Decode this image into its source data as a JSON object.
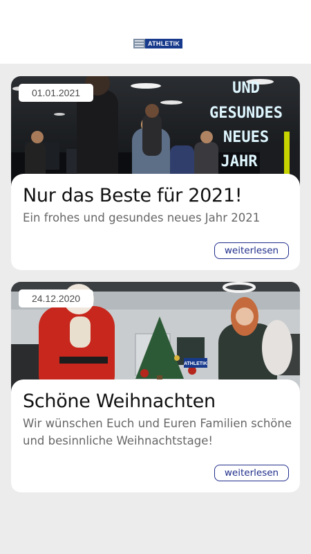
{
  "header": {
    "logo_text": "ATHLETIK"
  },
  "posts": [
    {
      "date": "01.01.2021",
      "title": "Nur das Beste für 2021!",
      "excerpt": "Ein frohes und gesundes neues Jahr 2021",
      "read_more_label": "weiterlesen",
      "image_text": [
        "UND",
        "GESUNDES",
        "NEUES",
        "JAHR"
      ]
    },
    {
      "date": "24.12.2020",
      "title": "Schöne Weihnachten",
      "excerpt": "Wir wünschen Euch und Euren Familien schöne und besinnliche Weihnachtstage!",
      "read_more_label": "weiterlesen",
      "image_text": [
        "ATHLETIK"
      ]
    }
  ]
}
